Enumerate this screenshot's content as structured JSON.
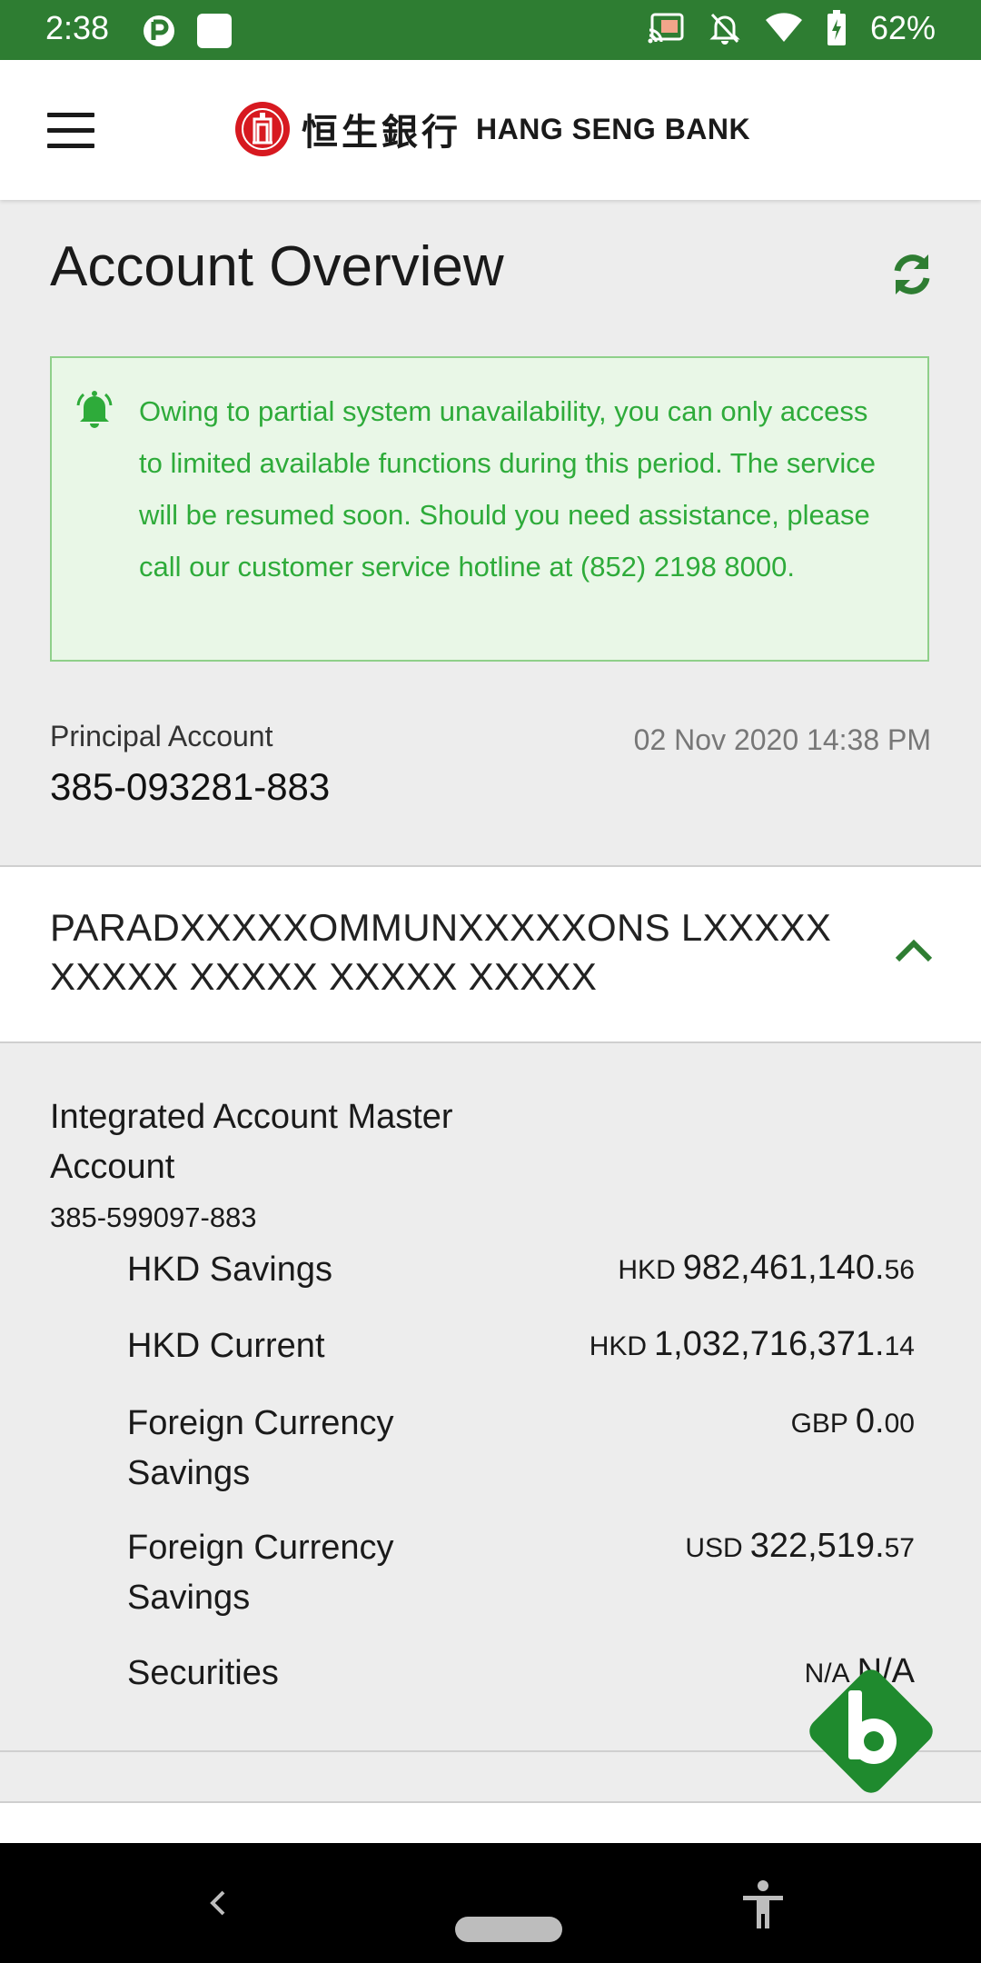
{
  "status_bar": {
    "time": "2:38",
    "battery": "62%",
    "icons": [
      "app-icon",
      "blank-notification-icon",
      "cast-icon",
      "bell-off-icon",
      "wifi-icon",
      "battery-charging-icon"
    ]
  },
  "header": {
    "brand_cn": "恒生銀行",
    "brand_en": "HANG SENG BANK",
    "icons": [
      "menu-icon",
      "hang-seng-logo"
    ]
  },
  "page": {
    "title": "Account Overview"
  },
  "notice": {
    "text": "Owing to partial system unavailability, you can only access to limited available functions during this period. The service will be resumed soon. Should you need assistance, please call our customer service hotline at (852) 2198 8000."
  },
  "principal": {
    "label": "Principal Account",
    "number": "385-093281-883",
    "timestamp": "02 Nov 2020 14:38 PM"
  },
  "customer": {
    "name": "PARADXXXXXOMMUNXXXXXONS LXXXXX XXXXX XXXXX XXXXX XXXXX"
  },
  "account": {
    "title": "Integrated Account Master Account",
    "number": "385-599097-883",
    "rows": [
      {
        "label": "HKD Savings",
        "currency": "HKD",
        "amount_int": "982,461,140.",
        "amount_dec": "56"
      },
      {
        "label": "HKD Current",
        "currency": "HKD",
        "amount_int": "1,032,716,371.",
        "amount_dec": "14"
      },
      {
        "label": "Foreign Currency Savings",
        "currency": "GBP",
        "amount_int": "0.",
        "amount_dec": "00"
      },
      {
        "label": "Foreign Currency Savings",
        "currency": "USD",
        "amount_int": "322,519.",
        "amount_dec": "57"
      },
      {
        "label": "Securities",
        "currency": "N/A",
        "amount_int": "N/A",
        "amount_dec": ""
      }
    ]
  },
  "colors": {
    "status_bar": "#2e7d32",
    "accent_green": "#2e7d32",
    "notice_text": "#2eab3a",
    "notice_bg": "#e9f7e7",
    "notice_border": "#8fd08a",
    "brand_red": "#d71920"
  }
}
